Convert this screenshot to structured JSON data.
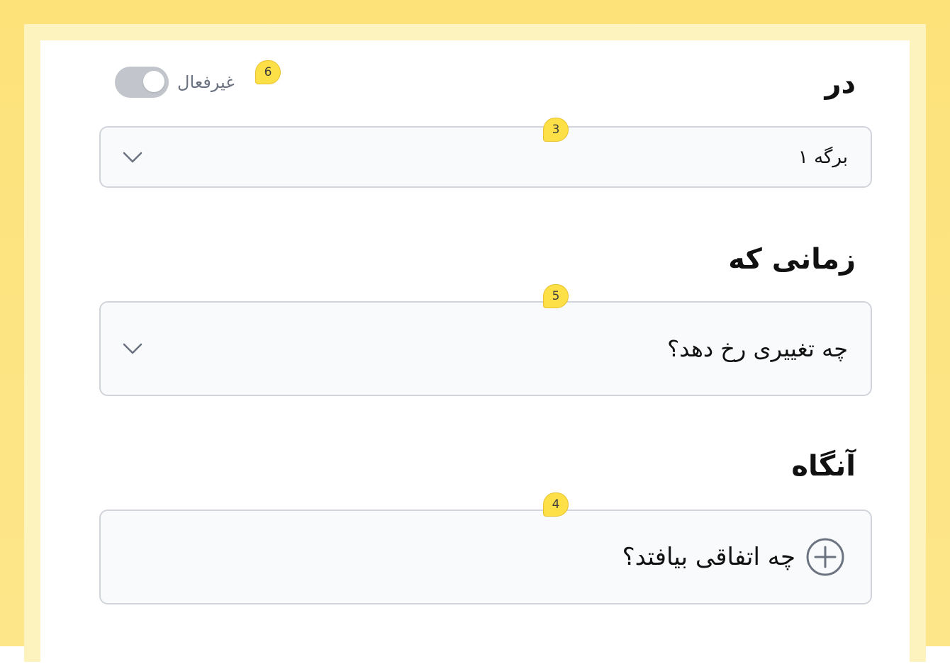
{
  "trigger": {
    "in_label": "در",
    "toggle_state_label": "غیرفعال",
    "toggle_on": false,
    "page_select_value": "برگه ۱"
  },
  "when": {
    "title": "زمانی که",
    "select_placeholder": "چه تغییری رخ دهد؟"
  },
  "then": {
    "title": "آنگاه",
    "add_action_label": "چه اتفاقی بیافتد؟"
  },
  "badges": {
    "toggle": "6",
    "page_select": "3",
    "when_select": "5",
    "then_box": "4"
  },
  "icons": {
    "chevron": "chevron-down-icon",
    "add": "plus-circle-icon"
  },
  "colors": {
    "frame": "#fde27a",
    "badge": "#fde047",
    "field_bg": "#f9fafb",
    "field_border": "#d1d5db",
    "toggle_off": "#c2c6cc"
  }
}
